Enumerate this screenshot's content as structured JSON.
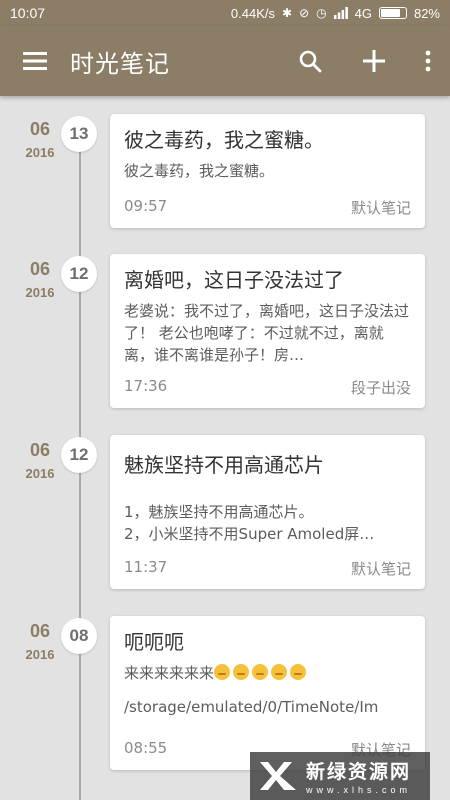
{
  "status": {
    "time": "10:07",
    "speed": "0.44K/s",
    "network": "4G",
    "battery": "82%",
    "battery_level": 0.82,
    "icons": [
      "bluetooth-icon",
      "alarm-icon",
      "clock-icon",
      "signal-icon"
    ]
  },
  "appbar": {
    "title": "时光笔记",
    "icons": [
      "menu-icon",
      "search-icon",
      "add-icon",
      "more-icon"
    ]
  },
  "entries": [
    {
      "month": "06",
      "year": "2016",
      "day": "13",
      "title": "彼之毒药，我之蜜糖。",
      "body": "彼之毒药，我之蜜糖。",
      "time": "09:57",
      "category": "默认笔记"
    },
    {
      "month": "06",
      "year": "2016",
      "day": "12",
      "title": "离婚吧，这日子没法过了",
      "body": "老婆说：我不过了，离婚吧，这日子没法过了！ 老公也咆哮了：不过就不过，离就离，谁不离谁是孙子！房…",
      "time": "17:36",
      "category": "段子出没"
    },
    {
      "month": "06",
      "year": "2016",
      "day": "12",
      "title": "魅族坚持不用高通芯片",
      "body_line1": "1，魅族坚持不用高通芯片。",
      "body_line2": "2，小米坚持不用Super Amoled屏…",
      "time": "11:37",
      "category": "默认笔记"
    },
    {
      "month": "06",
      "year": "2016",
      "day": "08",
      "title": "呃呃呃",
      "body": "来来来来来来",
      "emoji_count": 5,
      "path": "/storage/emulated/0/TimeNote/Im",
      "time": "08:55",
      "category": "默认笔记"
    }
  ],
  "watermark": {
    "main": "新绿资源网",
    "sub": "www.xlhs.com",
    "colors": {
      "bg": "#3c3c3c"
    }
  },
  "colors": {
    "primary": "#8b7d66",
    "background": "#e2e2e2",
    "card": "#ffffff",
    "date": "#8b7d66"
  }
}
